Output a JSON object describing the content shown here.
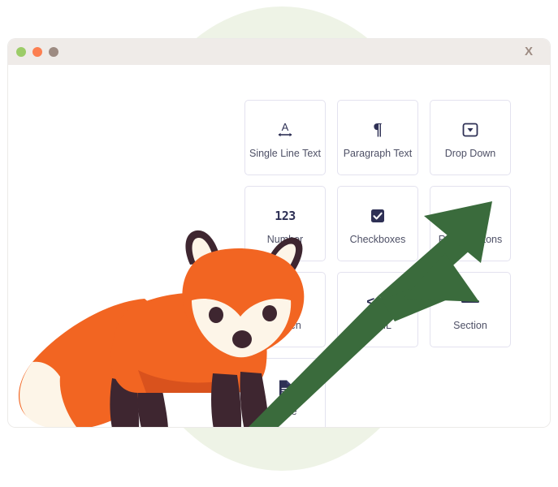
{
  "window": {
    "titlebar": {
      "dots": [
        {
          "name": "close-dot",
          "color": "#9ccc68"
        },
        {
          "name": "minimize-dot",
          "color": "#fc7f51"
        },
        {
          "name": "maximize-dot",
          "color": "#9d8b82"
        }
      ],
      "close_label": "X"
    }
  },
  "palette": {
    "backdrop_green": "#eef3e6",
    "titlebar": "#efebe8",
    "tile_border": "#e3e2ef",
    "icon_navy": "#2e3055",
    "label_text": "#4e5066",
    "arrow_green": "#3a6b3c",
    "fox_orange": "#f26522",
    "fox_orange_dark": "#d9521d",
    "fox_cream": "#fdf5e8",
    "fox_dark": "#3e2630"
  },
  "grid": {
    "tiles": [
      {
        "id": "single-line-text",
        "label": "Single Line Text",
        "icon": "text-a-width-icon"
      },
      {
        "id": "paragraph-text",
        "label": "Paragraph Text",
        "icon": "pilcrow-icon"
      },
      {
        "id": "drop-down",
        "label": "Drop Down",
        "icon": "dropdown-icon"
      },
      {
        "id": "number",
        "label": "Number",
        "icon": "number-123-icon"
      },
      {
        "id": "checkboxes",
        "label": "Checkboxes",
        "icon": "checkbox-icon"
      },
      {
        "id": "radio-buttons",
        "label": "Radio Buttons",
        "icon": "radio-icon"
      },
      {
        "id": "hidden",
        "label": "Hidden",
        "icon": "eye-slash-icon"
      },
      {
        "id": "html",
        "label": "HTML",
        "icon": "code-brackets-icon"
      },
      {
        "id": "section",
        "label": "Section",
        "icon": "section-dash-icon"
      },
      {
        "id": "page",
        "label": "Page",
        "icon": "page-document-icon"
      }
    ]
  },
  "decorations": {
    "fox_illustration": "fox-mascot-illustration",
    "arrow": "double-headed-diagonal-arrow"
  }
}
